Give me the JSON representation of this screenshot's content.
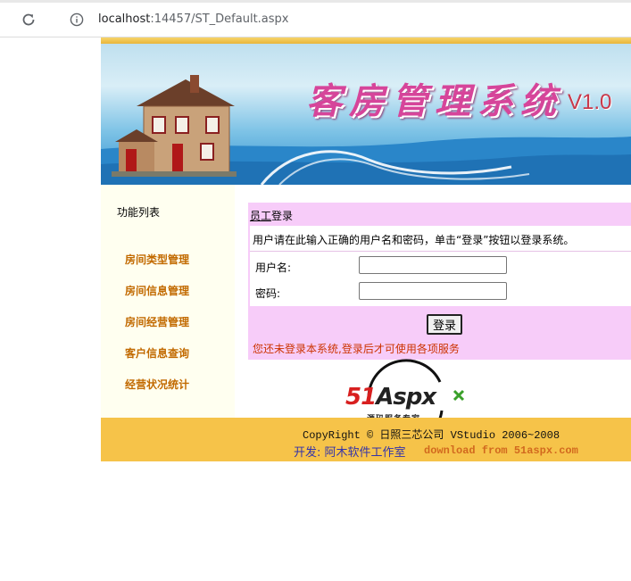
{
  "browser": {
    "url_host": "localhost",
    "url_rest": ":14457/ST_Default.aspx"
  },
  "banner": {
    "title": "客房管理系统",
    "version": "V1.0"
  },
  "sidebar": {
    "title": "功能列表",
    "items": [
      {
        "label": "房间类型管理"
      },
      {
        "label": "房间信息管理"
      },
      {
        "label": "房间经营管理"
      },
      {
        "label": "客户信息查询"
      },
      {
        "label": "经营状况统计"
      }
    ]
  },
  "login": {
    "title_underlined": "员工",
    "title_rest": "登录",
    "instruction": "用户请在此输入正确的用户名和密码，单击“登录”按钮以登录系统。",
    "username_label": "用户名:",
    "username_value": "",
    "password_label": "密码:",
    "password_value": "",
    "button_label": "登录",
    "notice": "您还未登录本系统,登录后才可使用各项服务"
  },
  "logo": {
    "text_red": "51",
    "text_dark": "Aspx",
    "tagline": "源码服务专家"
  },
  "footer": {
    "copyright": "CopyRight © 日照三芯公司 VStudio 2006~2008",
    "dev_label": "开发:",
    "dev_name": "阿木软件工作室",
    "download": "download from 51aspx.com"
  },
  "colors": {
    "accent_gold": "#f6c349",
    "panel_pink": "#f7ccf9",
    "link_orange": "#c26a00",
    "notice_red": "#cc3300"
  }
}
